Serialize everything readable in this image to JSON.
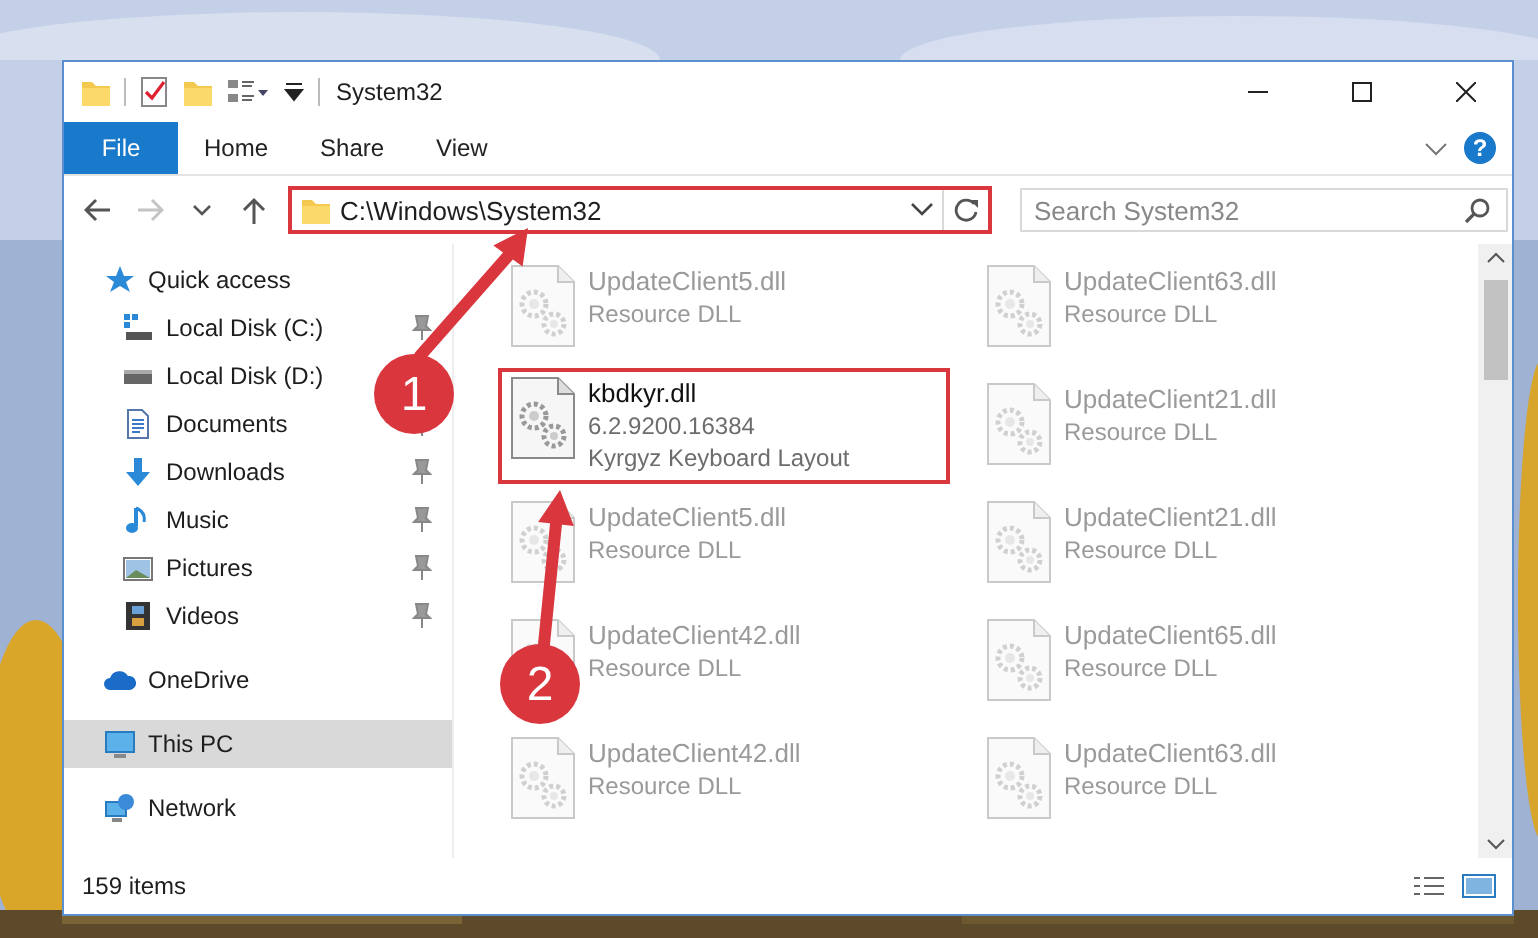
{
  "title_bar": {
    "title": "System32"
  },
  "ribbon": {
    "tabs": [
      {
        "label": "File",
        "kind": "file",
        "selected": false
      },
      {
        "label": "Home",
        "kind": "tab",
        "selected": false
      },
      {
        "label": "Share",
        "kind": "tab",
        "selected": false
      },
      {
        "label": "View",
        "kind": "tab",
        "selected": false
      }
    ],
    "help": "?"
  },
  "address_bar": {
    "path": "C:\\Windows\\System32",
    "highlighted": true
  },
  "search": {
    "placeholder": "Search System32"
  },
  "nav": {
    "items": [
      {
        "label": "Quick access",
        "kind": "star",
        "selected": false,
        "children": [
          {
            "label": "Local Disk (C:)",
            "kind": "system-drive",
            "selected": false,
            "pinned": true
          },
          {
            "label": "Local Disk (D:)",
            "kind": "drive",
            "selected": false
          },
          {
            "label": "Documents",
            "kind": "document",
            "selected": false,
            "pinned": true
          },
          {
            "label": "Downloads",
            "kind": "download",
            "selected": false,
            "pinned": true
          },
          {
            "label": "Music",
            "kind": "music",
            "selected": false,
            "pinned": true
          },
          {
            "label": "Pictures",
            "kind": "pictures",
            "selected": false,
            "pinned": true
          },
          {
            "label": "Videos",
            "kind": "video",
            "selected": false,
            "pinned": true
          }
        ]
      },
      {
        "label": "OneDrive",
        "kind": "cloud",
        "selected": false
      },
      {
        "label": "This PC",
        "kind": "computer",
        "selected": true
      },
      {
        "label": "Network",
        "kind": "network",
        "selected": false
      }
    ]
  },
  "files": [
    {
      "name": "UpdateClient5.dll",
      "description": "Resource DLL",
      "blurred": true,
      "highlighted": false
    },
    {
      "name": "UpdateClient63.dll",
      "description": "Resource DLL",
      "blurred": true,
      "highlighted": false
    },
    {
      "name": "kbdkyr.dll",
      "version": "6.2.9200.16384",
      "description": "Kyrgyz Keyboard Layout",
      "blurred": false,
      "highlighted": true
    },
    {
      "name": "UpdateClient21.dll",
      "description": "Resource DLL",
      "blurred": true,
      "highlighted": false
    },
    {
      "name": "UpdateClient5.dll",
      "description": "Resource DLL",
      "blurred": true,
      "highlighted": false
    },
    {
      "name": "UpdateClient21.dll",
      "description": "Resource DLL",
      "blurred": true,
      "highlighted": false
    },
    {
      "name": "UpdateClient42.dll",
      "description": "Resource DLL",
      "blurred": true,
      "highlighted": false
    },
    {
      "name": "UpdateClient65.dll",
      "description": "Resource DLL",
      "blurred": true,
      "highlighted": false
    },
    {
      "name": "UpdateClient42.dll",
      "description": "Resource DLL",
      "blurred": true,
      "highlighted": false
    },
    {
      "name": "UpdateClient63.dll",
      "description": "Resource DLL",
      "blurred": true,
      "highlighted": false
    }
  ],
  "annotations": [
    {
      "label": "1"
    },
    {
      "label": "2"
    }
  ],
  "status_bar": {
    "item_count": "159 items"
  }
}
